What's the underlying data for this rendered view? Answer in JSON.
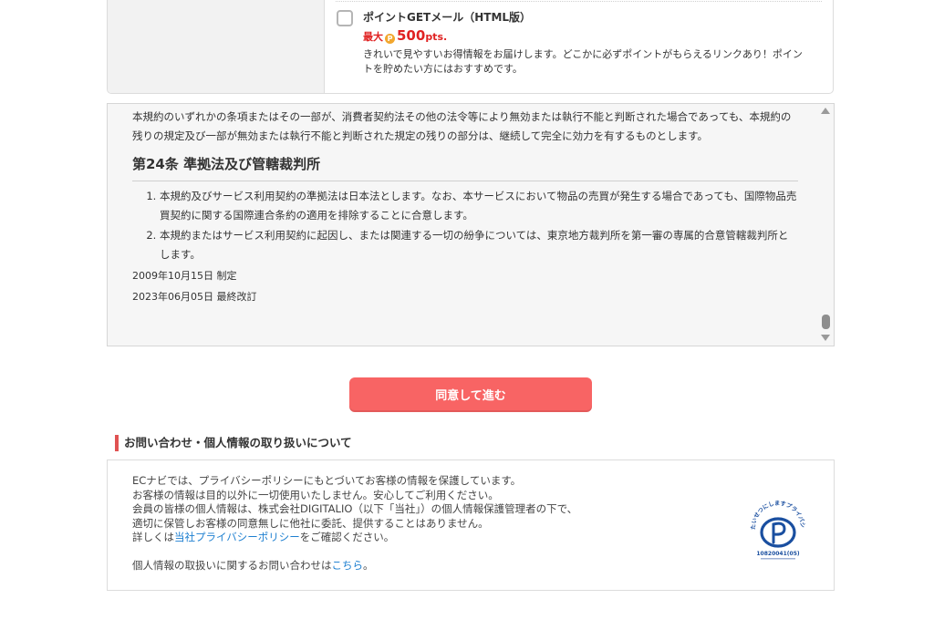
{
  "mail_option": {
    "title": "ポイントGETメール（HTML版）",
    "points_prefix": "最大",
    "coin_glyph": "P",
    "points_value": "500",
    "points_unit": "pts.",
    "description": "きれいで見やすいお得情報をお届けします。どこかに必ずポイントがもらえるリンクあり！ポイントを貯めたい方にはおすすめです。"
  },
  "terms": {
    "intro": "本規約のいずれかの条項またはその一部が、消費者契約法その他の法令等により無効または執行不能と判断された場合であっても、本規約の残りの規定及び一部が無効または執行不能と判断された規定の残りの部分は、継続して完全に効力を有するものとします。",
    "article_title": "第24条 準拠法及び管轄裁判所",
    "items": [
      "本規約及びサービス利用契約の準拠法は日本法とします。なお、本サービスにおいて物品の売買が発生する場合であっても、国際物品売買契約に関する国際連合条約の適用を排除することに合意します。",
      "本規約またはサービス利用契約に起因し、または関連する一切の紛争については、東京地方裁判所を第一審の専属的合意管轄裁判所とします。"
    ],
    "enacted": "2009年10月15日 制定",
    "revised": "2023年06月05日 最終改訂"
  },
  "agree_button": {
    "label": "同意して進む"
  },
  "contact": {
    "section_title": "お問い合わせ・個人情報の取り扱いについて",
    "line1": "ECナビでは、プライバシーポリシーにもとづいてお客様の情報を保護しています。",
    "line2": "お客様の情報は目的以外に一切使用いたしません。安心してご利用ください。",
    "line3": "会員の皆様の個人情報は、株式会社DIGITALIO（以下「当社」）の個人情報保護管理者の下で、",
    "line4": "適切に保管しお客様の同意無しに他社に委託、提供することはありません。",
    "line5_prefix": "詳しくは",
    "privacy_link": "当社プライバシーポリシー",
    "line5_suffix": "をご確認ください。",
    "inquiry_prefix": "個人情報の取扱いに関するお問い合わせは",
    "inquiry_link": "こちら",
    "inquiry_suffix": "。"
  },
  "privacy_mark": {
    "arc_text": "たいせつにしますプライバシー",
    "number": "10820041(05)"
  },
  "colors": {
    "accent": "#f86464",
    "points": "#e02222",
    "link": "#1d7fd0",
    "mark_blue": "#1a4fa0"
  }
}
